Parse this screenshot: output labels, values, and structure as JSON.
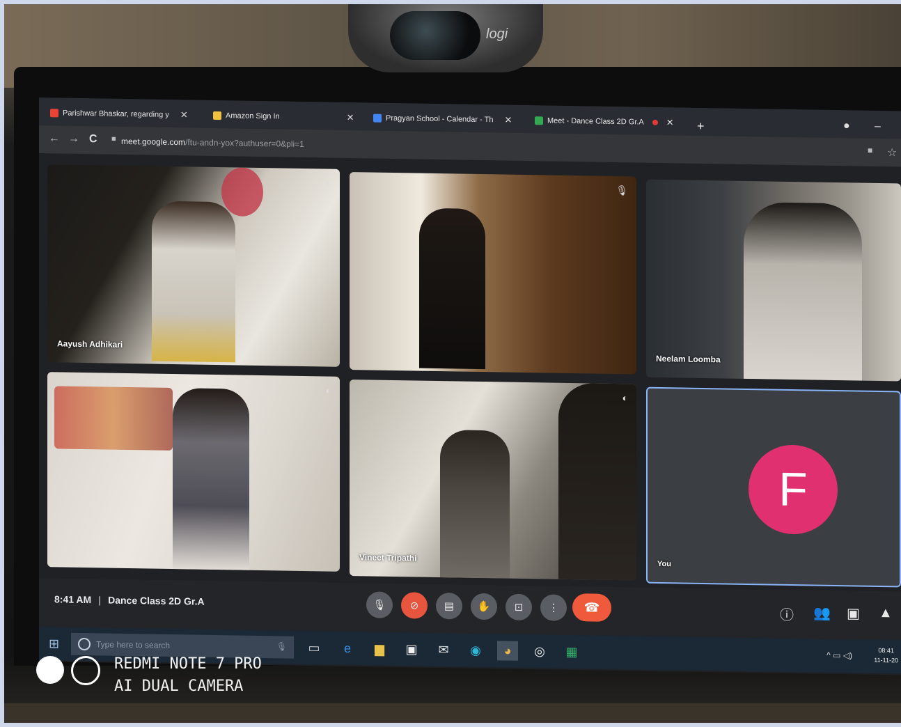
{
  "webcam": {
    "brand": "logi"
  },
  "browser": {
    "tabs": [
      {
        "label": "Parishwar Bhaskar, regarding y",
        "favicon_color": "#ea4335"
      },
      {
        "label": "Amazon Sign In",
        "favicon_color": "#f0c040"
      },
      {
        "label": "Pragyan School - Calendar - Th",
        "favicon_color": "#4285f4"
      },
      {
        "label": "Meet - Dance Class 2D Gr.A",
        "favicon_color": "#34a853"
      }
    ],
    "url_host": "meet.google.com",
    "url_path": "/ftu-andn-yox?authuser=0&pli=1"
  },
  "participants": [
    {
      "name": "Aayush Adhikari"
    },
    {
      "name": ""
    },
    {
      "name": "Neelam Loomba"
    },
    {
      "name": ""
    },
    {
      "name": "Vineet Tripathi"
    },
    {
      "name": "You",
      "avatar_letter": "F",
      "avatar_color": "#e0306f"
    }
  ],
  "meeting": {
    "time": "8:41 AM",
    "title": "Dance Class 2D Gr.A",
    "end_call_color": "#ee5a3b"
  },
  "taskbar": {
    "search_placeholder": "Type here to search",
    "clock_time": "08:41",
    "clock_date": "11-11-20"
  },
  "watermark": {
    "line1": "REDMI NOTE 7 PRO",
    "line2": "AI DUAL CAMERA"
  }
}
